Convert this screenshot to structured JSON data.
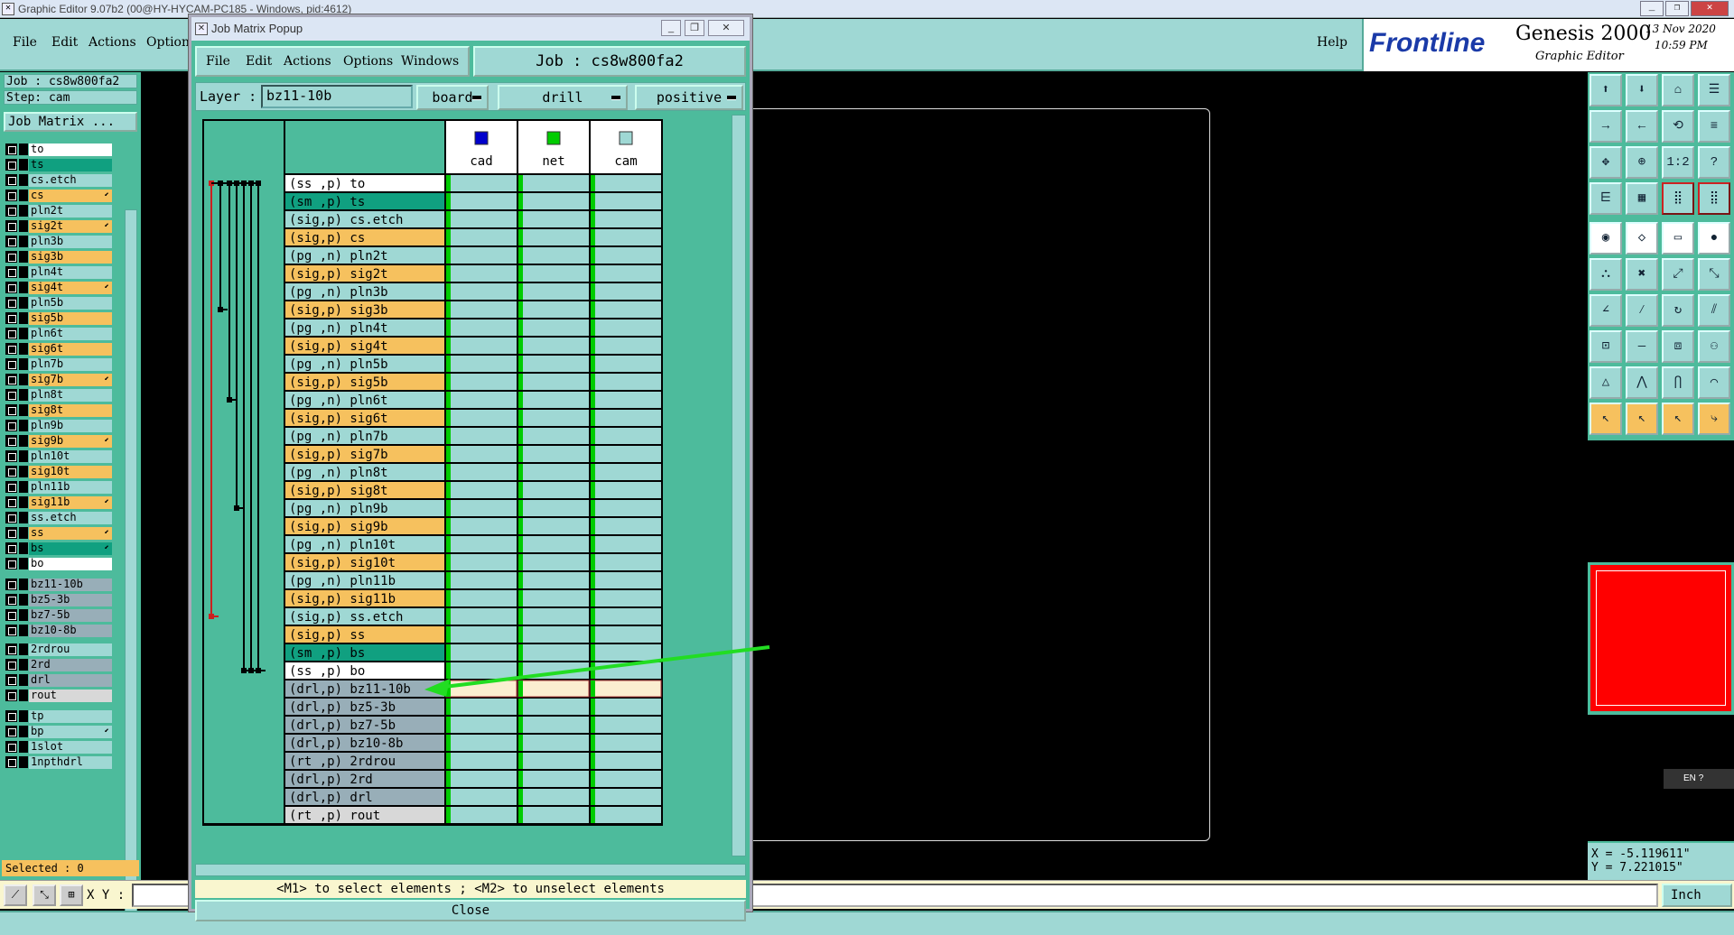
{
  "window": {
    "title": "Graphic Editor 9.07b2 (00@HY-HYCAM-PC185 - Windows, pid:4612)"
  },
  "menubar": {
    "items": [
      "File",
      "Edit",
      "Actions",
      "Options"
    ],
    "help": "Help"
  },
  "brand": {
    "logo": "Frontline",
    "product": "Genesis 2000",
    "subtitle": "Graphic Editor",
    "date": "13 Nov 2020",
    "time": "10:59 PM"
  },
  "left_panel": {
    "job": "Job : cs8w800fa2",
    "step": "Step: cam",
    "job_matrix_button": "Job Matrix ...",
    "layers": [
      {
        "name": "to",
        "color": "#ffffff",
        "arrow": false
      },
      {
        "name": "ts",
        "color": "#10a080",
        "arrow": false
      },
      {
        "name": "cs.etch",
        "color": "#9fd8d4",
        "arrow": false
      },
      {
        "name": "cs",
        "color": "#f6c15e",
        "arrow": true
      },
      {
        "name": "pln2t",
        "color": "#9fd8d4",
        "arrow": false
      },
      {
        "name": "sig2t",
        "color": "#f6c15e",
        "arrow": true
      },
      {
        "name": "pln3b",
        "color": "#9fd8d4",
        "arrow": false
      },
      {
        "name": "sig3b",
        "color": "#f6c15e",
        "arrow": false
      },
      {
        "name": "pln4t",
        "color": "#9fd8d4",
        "arrow": false
      },
      {
        "name": "sig4t",
        "color": "#f6c15e",
        "arrow": true
      },
      {
        "name": "pln5b",
        "color": "#9fd8d4",
        "arrow": false
      },
      {
        "name": "sig5b",
        "color": "#f6c15e",
        "arrow": false
      },
      {
        "name": "pln6t",
        "color": "#9fd8d4",
        "arrow": false
      },
      {
        "name": "sig6t",
        "color": "#f6c15e",
        "arrow": false
      },
      {
        "name": "pln7b",
        "color": "#9fd8d4",
        "arrow": false
      },
      {
        "name": "sig7b",
        "color": "#f6c15e",
        "arrow": true
      },
      {
        "name": "pln8t",
        "color": "#9fd8d4",
        "arrow": false
      },
      {
        "name": "sig8t",
        "color": "#f6c15e",
        "arrow": false
      },
      {
        "name": "pln9b",
        "color": "#9fd8d4",
        "arrow": false
      },
      {
        "name": "sig9b",
        "color": "#f6c15e",
        "arrow": true
      },
      {
        "name": "pln10t",
        "color": "#9fd8d4",
        "arrow": false
      },
      {
        "name": "sig10t",
        "color": "#f6c15e",
        "arrow": false
      },
      {
        "name": "pln11b",
        "color": "#9fd8d4",
        "arrow": false
      },
      {
        "name": "sig11b",
        "color": "#f6c15e",
        "arrow": true
      },
      {
        "name": "ss.etch",
        "color": "#9fd8d4",
        "arrow": false
      },
      {
        "name": "ss",
        "color": "#f6c15e",
        "arrow": true
      },
      {
        "name": "bs",
        "color": "#10a080",
        "arrow": true
      },
      {
        "name": "bo",
        "color": "#ffffff",
        "arrow": false
      },
      {
        "name": "bz11-10b",
        "color": "#98aeb8",
        "arrow": false
      },
      {
        "name": "bz5-3b",
        "color": "#98aeb8",
        "arrow": false
      },
      {
        "name": "bz7-5b",
        "color": "#98aeb8",
        "arrow": false
      },
      {
        "name": "bz10-8b",
        "color": "#98aeb8",
        "arrow": false
      },
      {
        "name": "2rdrou",
        "color": "#9fd8d4",
        "arrow": false
      },
      {
        "name": "2rd",
        "color": "#98aeb8",
        "arrow": false
      },
      {
        "name": "drl",
        "color": "#98aeb8",
        "arrow": false
      },
      {
        "name": "rout",
        "color": "#d8d8d8",
        "arrow": false
      },
      {
        "name": "tp",
        "color": "#9fd8d4",
        "arrow": false
      },
      {
        "name": "bp",
        "color": "#9fd8d4",
        "arrow": true
      },
      {
        "name": "1slot",
        "color": "#9fd8d4",
        "arrow": false
      },
      {
        "name": "1npthdrl",
        "color": "#9fd8d4",
        "arrow": false
      }
    ],
    "selected": "Selected : 0"
  },
  "popup": {
    "title": "Job Matrix Popup",
    "menu": [
      "File",
      "Edit",
      "Actions",
      "Options",
      "Windows"
    ],
    "job_label": "Job : cs8w800fa2",
    "layer_label": "Layer :",
    "layer_value": "bz11-10b",
    "context": "board",
    "type": "drill",
    "polarity": "positive",
    "steps": [
      {
        "name": "cad",
        "color": "#0000cc"
      },
      {
        "name": "net",
        "color": "#00cc00"
      },
      {
        "name": "cam",
        "color": "#9fd8d4"
      }
    ],
    "rows": [
      {
        "label": "(ss ,p) to",
        "color": "#ffffff"
      },
      {
        "label": "(sm ,p) ts",
        "color": "#10a080"
      },
      {
        "label": "(sig,p) cs.etch",
        "color": "#9fd8d4"
      },
      {
        "label": "(sig,p) cs",
        "color": "#f6c15e"
      },
      {
        "label": "(pg ,n) pln2t",
        "color": "#9fd8d4"
      },
      {
        "label": "(sig,p) sig2t",
        "color": "#f6c15e"
      },
      {
        "label": "(pg ,n) pln3b",
        "color": "#9fd8d4"
      },
      {
        "label": "(sig,p) sig3b",
        "color": "#f6c15e"
      },
      {
        "label": "(pg ,n) pln4t",
        "color": "#9fd8d4"
      },
      {
        "label": "(sig,p) sig4t",
        "color": "#f6c15e"
      },
      {
        "label": "(pg ,n) pln5b",
        "color": "#9fd8d4"
      },
      {
        "label": "(sig,p) sig5b",
        "color": "#f6c15e"
      },
      {
        "label": "(pg ,n) pln6t",
        "color": "#9fd8d4"
      },
      {
        "label": "(sig,p) sig6t",
        "color": "#f6c15e"
      },
      {
        "label": "(pg ,n) pln7b",
        "color": "#9fd8d4"
      },
      {
        "label": "(sig,p) sig7b",
        "color": "#f6c15e"
      },
      {
        "label": "(pg ,n) pln8t",
        "color": "#9fd8d4"
      },
      {
        "label": "(sig,p) sig8t",
        "color": "#f6c15e"
      },
      {
        "label": "(pg ,n) pln9b",
        "color": "#9fd8d4"
      },
      {
        "label": "(sig,p) sig9b",
        "color": "#f6c15e"
      },
      {
        "label": "(pg ,n) pln10t",
        "color": "#9fd8d4"
      },
      {
        "label": "(sig,p) sig10t",
        "color": "#f6c15e"
      },
      {
        "label": "(pg ,n) pln11b",
        "color": "#9fd8d4"
      },
      {
        "label": "(sig,p) sig11b",
        "color": "#f6c15e"
      },
      {
        "label": "(sig,p) ss.etch",
        "color": "#9fd8d4"
      },
      {
        "label": "(sig,p) ss",
        "color": "#f6c15e"
      },
      {
        "label": "(sm ,p) bs",
        "color": "#10a080"
      },
      {
        "label": "(ss ,p) bo",
        "color": "#ffffff"
      },
      {
        "label": "(drl,p) bz11-10b",
        "color": "#98aeb8",
        "selected": true
      },
      {
        "label": "(drl,p) bz5-3b",
        "color": "#98aeb8"
      },
      {
        "label": "(drl,p) bz7-5b",
        "color": "#98aeb8"
      },
      {
        "label": "(drl,p) bz10-8b",
        "color": "#98aeb8"
      },
      {
        "label": "(rt ,p) 2rdrou",
        "color": "#98aeb8"
      },
      {
        "label": "(drl,p) 2rd",
        "color": "#98aeb8"
      },
      {
        "label": "(drl,p) drl",
        "color": "#98aeb8"
      },
      {
        "label": "(rt ,p) rout",
        "color": "#d8d8d8"
      }
    ],
    "hint": "<M1> to select elements ; <M2> to unselect elements",
    "close": "Close"
  },
  "coords": {
    "x": "X = -5.119611\"",
    "y": "Y = 7.221015\""
  },
  "bottombar": {
    "xy_label": "X Y :",
    "units": "Inch"
  },
  "lang": "EN",
  "colors": {
    "accent": "#4dbb9c",
    "panel": "#9fd8d4",
    "signal": "#f6c15e",
    "minimap": "#ff0000",
    "arrow": "#22dd22"
  }
}
